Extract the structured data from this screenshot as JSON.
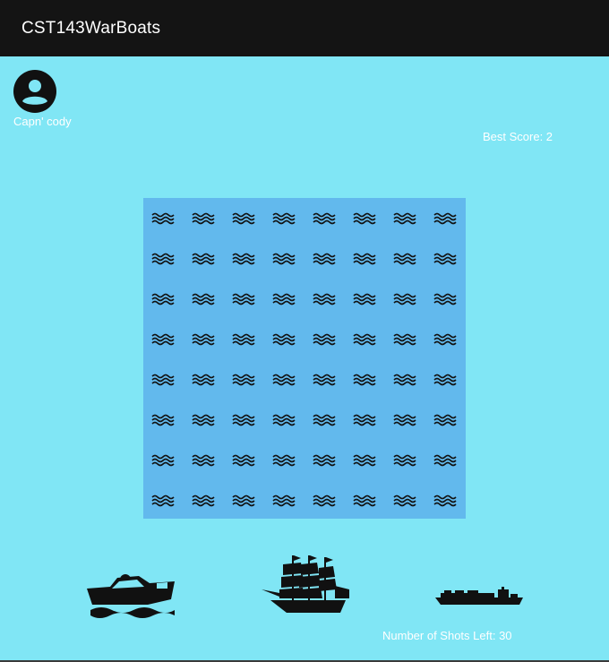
{
  "app_bar": {
    "title": "CST143WarBoats"
  },
  "player": {
    "name": "Capn' cody",
    "avatar_icon": "account-circle-icon"
  },
  "stats": {
    "best_score": "Best Score: 2",
    "shots_left": "Number of Shots Left: 30"
  },
  "board": {
    "rows": 8,
    "cols": 8,
    "cell_icon": "water-waves-icon"
  },
  "fleet": [
    "speedboat-icon",
    "sailing-ship-icon",
    "cargo-ship-icon"
  ],
  "colors": {
    "background": "#80e6f5",
    "board": "#62b9ed",
    "app_bar": "#141414",
    "text": "#ffffff",
    "icon": "#111111"
  }
}
